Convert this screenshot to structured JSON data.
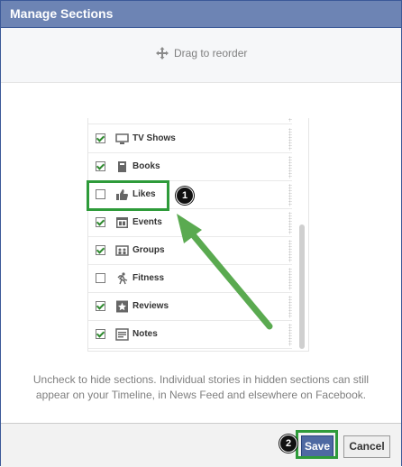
{
  "dialog": {
    "title": "Manage Sections",
    "drag_hint": "Drag to reorder",
    "help_text": "Uncheck to hide sections. Individual stories in hidden sections can still appear on your Timeline, in News Feed and elsewhere on Facebook.",
    "save_label": "Save",
    "cancel_label": "Cancel"
  },
  "sections": [
    {
      "label": "TV Shows",
      "checked": true,
      "icon": "tv-icon"
    },
    {
      "label": "Books",
      "checked": true,
      "icon": "book-icon"
    },
    {
      "label": "Likes",
      "checked": false,
      "icon": "thumbs-up-icon"
    },
    {
      "label": "Events",
      "checked": true,
      "icon": "calendar-icon"
    },
    {
      "label": "Groups",
      "checked": true,
      "icon": "group-icon"
    },
    {
      "label": "Fitness",
      "checked": false,
      "icon": "runner-icon"
    },
    {
      "label": "Reviews",
      "checked": true,
      "icon": "star-icon"
    },
    {
      "label": "Notes",
      "checked": true,
      "icon": "note-icon"
    }
  ],
  "annotations": {
    "badge_1": "1",
    "badge_2": "2",
    "highlight_color": "#2e9b3a"
  },
  "colors": {
    "titlebar": "#6d84b4",
    "primary_button": "#4e69a2"
  }
}
